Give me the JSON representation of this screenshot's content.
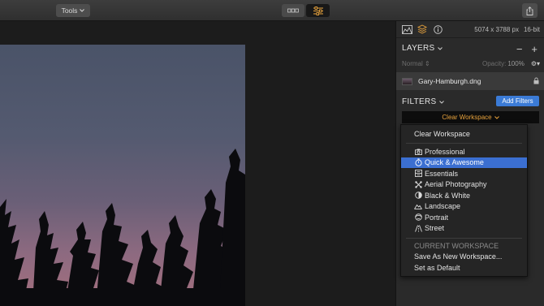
{
  "toolbar": {
    "tools_label": "Tools",
    "tools_icon": "chevron-down-icon",
    "view_buttons": [
      "compare-icon",
      "adjustments-icon"
    ],
    "share_icon": "share-icon",
    "active_color": "#e8a33d"
  },
  "panel": {
    "header_icons": [
      "histogram-icon",
      "layers-icon",
      "info-icon"
    ],
    "dimensions": "5074 x 3788 px",
    "bit_depth": "16-bit",
    "layers": {
      "title": "LAYERS",
      "blend_mode": "Normal",
      "opacity_label": "Opacity:",
      "opacity_value": "100%",
      "items": [
        {
          "name": "Gary-Hamburgh.dng",
          "locked": true
        }
      ]
    },
    "filters": {
      "title": "FILTERS",
      "add_button": "Add Filters",
      "workspace": "Clear Workspace"
    }
  },
  "menu": {
    "top_item": "Clear Workspace",
    "items": [
      {
        "label": "Professional",
        "icon": "camera-icon",
        "selected": false
      },
      {
        "label": "Quick & Awesome",
        "icon": "stopwatch-icon",
        "selected": true
      },
      {
        "label": "Essentials",
        "icon": "film-icon",
        "selected": false
      },
      {
        "label": "Aerial Photography",
        "icon": "drone-icon",
        "selected": false
      },
      {
        "label": "Black & White",
        "icon": "half-circle-icon",
        "selected": false
      },
      {
        "label": "Landscape",
        "icon": "mountain-icon",
        "selected": false
      },
      {
        "label": "Portrait",
        "icon": "face-icon",
        "selected": false
      },
      {
        "label": "Street",
        "icon": "street-icon",
        "selected": false
      }
    ],
    "section_header": "CURRENT WORKSPACE",
    "actions": [
      "Save As New Workspace...",
      "Set as Default"
    ],
    "highlight_color": "#3b6fd1"
  }
}
